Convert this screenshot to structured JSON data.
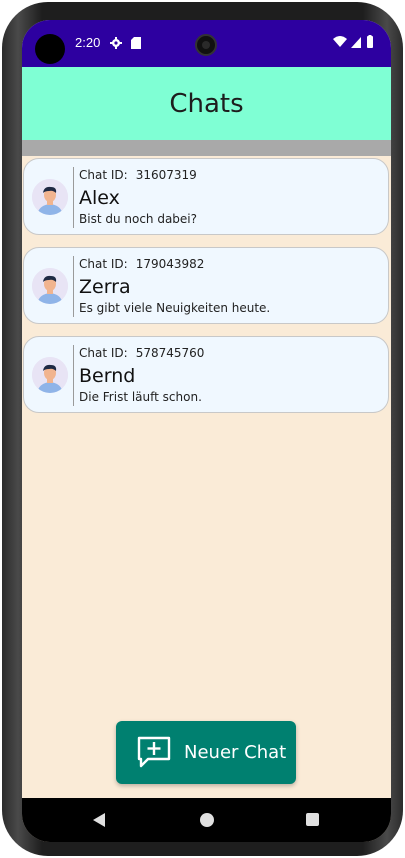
{
  "status_bar": {
    "time": "2:20",
    "icons": [
      "gear-icon",
      "sd-card-icon",
      "wifi-icon",
      "signal-icon",
      "battery-icon"
    ]
  },
  "app_bar": {
    "title": "Chats",
    "background_color": "#7fffd4"
  },
  "chats": [
    {
      "id_label": "Chat ID:",
      "id": "31607319",
      "name": "Alex",
      "last_message": "Bist du noch dabei?"
    },
    {
      "id_label": "Chat ID:",
      "id": "179043982",
      "name": "Zerra",
      "last_message": "Es gibt viele Neuigkeiten heute."
    },
    {
      "id_label": "Chat ID:",
      "id": "578745760",
      "name": "Bernd",
      "last_message": "Die Frist läuft schon."
    }
  ],
  "new_chat_button": {
    "label": "Neuer Chat",
    "icon": "add-chat-icon",
    "color": "#008070"
  },
  "nav_bar": {
    "icons": [
      "back-icon",
      "home-icon",
      "recents-icon"
    ]
  },
  "colors": {
    "status_bar": "#2d00a0",
    "content_background": "#faebd7",
    "card_background": "#f0f8ff"
  }
}
